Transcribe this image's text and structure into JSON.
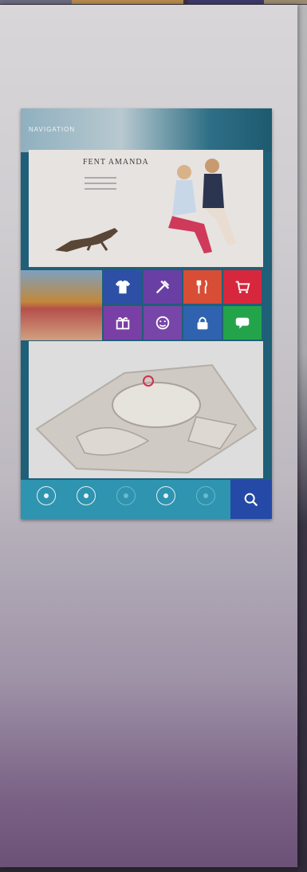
{
  "screen": {
    "nav_title": "NAVIGATION",
    "hero": {
      "brand": "FENT AMANDA"
    },
    "tiles": [
      {
        "icon": "tshirt-icon",
        "color": "#2e4fa6"
      },
      {
        "icon": "tools-icon",
        "color": "#6a3fa4"
      },
      {
        "icon": "fork-knife-icon",
        "color": "#d84d36"
      },
      {
        "icon": "shopping-cart-icon",
        "color": "#d6273d"
      },
      {
        "icon": "gift-icon",
        "color": "#7a3fa6"
      },
      {
        "icon": "face-icon",
        "color": "#7846a8"
      },
      {
        "icon": "lock-icon",
        "color": "#2f63b0"
      },
      {
        "icon": "chat-icon",
        "color": "#24a44a"
      }
    ],
    "bottom_bar": {
      "buttons": [
        "zoom-in-icon",
        "center-icon",
        "minus-icon",
        "plus-icon",
        "info-icon"
      ],
      "search": "search-icon"
    }
  }
}
